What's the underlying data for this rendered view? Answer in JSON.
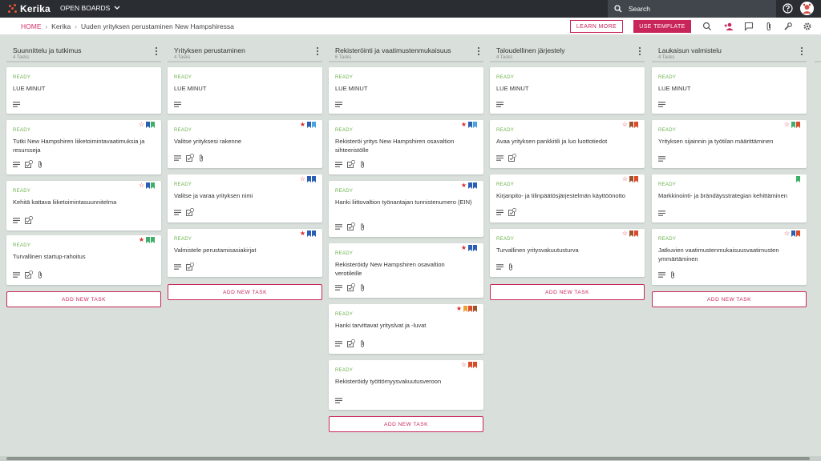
{
  "app": {
    "logo_text": "Kerika",
    "open_boards_label": "OPEN BOARDS",
    "search_placeholder": "Search"
  },
  "breadcrumb": {
    "home": "HOME",
    "org": "Kerika",
    "board": "Uuden yrityksen perustaminen New Hampshiressa"
  },
  "toolbar": {
    "learn_more": "LEARN MORE",
    "use_template": "USE TEMPLATE"
  },
  "colors": {
    "accent": "#c8255a",
    "ready": "#6ab04c",
    "topbar": "#2a2e33",
    "board_bg": "#d9e0dc"
  },
  "columns": [
    {
      "title": "Suunnittelu ja tutkimus",
      "count": "4 Tasks",
      "add_label": "ADD NEW TASK",
      "cards": [
        {
          "status": "READY",
          "title": "LUE MINUT",
          "flags": [],
          "star": "none",
          "icons": [
            "description-icon"
          ]
        },
        {
          "status": "READY",
          "title": "Tutki New Hampshiren liiketoimintavaatimuksia ja resursseja",
          "star": "outline",
          "flags": [
            "#2b5fb4",
            "#3fae6a"
          ],
          "icons": [
            "description-icon",
            "checklist-icon",
            "attachment-icon"
          ],
          "checklist_count": "2"
        },
        {
          "status": "READY",
          "title": "Kehitä kattava liiketoimintasuunnitelma",
          "star": "outline",
          "flags": [
            "#2b5fb4",
            "#3fae6a"
          ],
          "icons": [
            "description-icon",
            "checklist-icon"
          ],
          "checklist_count": "2"
        },
        {
          "status": "READY",
          "title": "Turvallinen startup-rahoitus",
          "star": "filled",
          "flags": [
            "#3fae6a",
            "#3fae6a"
          ],
          "icons": [
            "description-icon",
            "checklist-icon",
            "attachment-icon"
          ],
          "checklist_count": "2"
        }
      ]
    },
    {
      "title": "Yrityksen perustaminen",
      "count": "4 Tasks",
      "add_label": "ADD NEW TASK",
      "cards": [
        {
          "status": "READY",
          "title": "LUE MINUT",
          "flags": [],
          "star": "none",
          "icons": [
            "description-icon"
          ]
        },
        {
          "status": "READY",
          "title": "Valitse yrityksesi rakenne",
          "star": "filled",
          "flags": [
            "#2b5fb4",
            "#4aa3df"
          ],
          "icons": [
            "description-icon",
            "checklist-icon",
            "attachment-icon"
          ],
          "checklist_count": "2"
        },
        {
          "status": "READY",
          "title": "Valitse ja varaa yrityksen nimi",
          "star": "outline",
          "flags": [
            "#2b5fb4",
            "#2b5fb4"
          ],
          "icons": [
            "description-icon",
            "checklist-icon"
          ],
          "checklist_count": "2"
        },
        {
          "status": "READY",
          "title": "Valmistele perustamisasiakirjat",
          "star": "filled",
          "flags": [
            "#2b5fb4",
            "#2b5fb4"
          ],
          "icons": [
            "description-icon",
            "checklist-icon"
          ],
          "checklist_count": "2"
        }
      ]
    },
    {
      "title": "Rekisteröinti ja vaatimustenmukaisuus",
      "count": "6 Tasks",
      "add_label": "ADD NEW TASK",
      "cards": [
        {
          "status": "READY",
          "title": "LUE MINUT",
          "flags": [],
          "star": "none",
          "icons": [
            "description-icon"
          ]
        },
        {
          "status": "READY",
          "title": "Rekisteröi yritys New Hampshiren osavaltion sihteeristölle",
          "star": "filled",
          "flags": [
            "#2b5fb4",
            "#4aa3df"
          ],
          "icons": [
            "description-icon",
            "checklist-icon",
            "attachment-icon"
          ],
          "checklist_count": "2"
        },
        {
          "status": "READY",
          "title": "Hanki liittovaltion työnantajan tunnistenumero (EIN)",
          "star": "filled",
          "flags": [
            "#2b5fb4",
            "#2b5fb4"
          ],
          "icons": [
            "description-icon",
            "checklist-icon",
            "attachment-icon"
          ],
          "checklist_count": "2"
        },
        {
          "status": "READY",
          "title": "Rekisteröidy New Hampshiren osavaltion verotileille",
          "star": "filled",
          "flags": [
            "#2b5fb4",
            "#2b5fb4"
          ],
          "icons": [
            "description-icon",
            "checklist-icon",
            "attachment-icon"
          ],
          "checklist_count": "2"
        },
        {
          "status": "READY",
          "title": "Hanki tarvittavat yrityslvat ja -luvat",
          "star": "filled",
          "flags": [
            "#f0a030",
            "#d94b2b",
            "#a0522d"
          ],
          "icons": [
            "description-icon",
            "checklist-icon",
            "attachment-icon"
          ],
          "checklist_count": "2"
        },
        {
          "status": "READY",
          "title": "Rekisteröidy työttömyysvakuutusveroon",
          "star": "outline",
          "flags": [
            "#d94b2b",
            "#d94b2b"
          ],
          "icons": [
            "description-icon"
          ]
        }
      ]
    },
    {
      "title": "Taloudellinen järjestely",
      "count": "4 Tasks",
      "add_label": "ADD NEW TASK",
      "cards": [
        {
          "status": "READY",
          "title": "LUE MINUT",
          "flags": [],
          "star": "none",
          "icons": [
            "description-icon"
          ]
        },
        {
          "status": "READY",
          "title": "Avaa yrityksen pankkitili ja luo luottotiedot",
          "star": "outline",
          "flags": [
            "#a0522d",
            "#d94b2b"
          ],
          "icons": [
            "description-icon",
            "checklist-icon"
          ],
          "checklist_count": "2"
        },
        {
          "status": "READY",
          "title": "Kirjanpito- ja tilinpäätösjärjestelmän käyttöönotto",
          "star": "outline",
          "flags": [
            "#a0522d",
            "#d94b2b"
          ],
          "icons": [
            "description-icon",
            "checklist-icon"
          ],
          "checklist_count": "2"
        },
        {
          "status": "READY",
          "title": "Turvallinen yritysvakuutusturva",
          "star": "outline",
          "flags": [
            "#a0522d",
            "#d94b2b"
          ],
          "icons": [
            "description-icon",
            "attachment-icon"
          ]
        }
      ]
    },
    {
      "title": "Laukaisun valmistelu",
      "count": "4 Tasks",
      "add_label": "ADD NEW TASK",
      "cards": [
        {
          "status": "READY",
          "title": "LUE MINUT",
          "flags": [],
          "star": "none",
          "icons": [
            "description-icon"
          ]
        },
        {
          "status": "READY",
          "title": "Yrityksen sijainnin ja työtilan määrittäminen",
          "star": "outline",
          "flags": [
            "#3fae6a",
            "#d94b2b"
          ],
          "icons": [
            "description-icon"
          ]
        },
        {
          "status": "READY",
          "title": "Markkinointi- ja brändäysstrategian kehittäminen",
          "star": "none",
          "flags": [
            "#3fae6a"
          ],
          "icons": [
            "description-icon"
          ]
        },
        {
          "status": "READY",
          "title": "Jatkuvien vaatimustenmukaisuusvaatimusten ymmärtäminen",
          "star": "outline",
          "flags": [
            "#2b5fb4",
            "#d94b2b"
          ],
          "icons": [
            "description-icon",
            "attachment-icon"
          ]
        }
      ]
    }
  ]
}
